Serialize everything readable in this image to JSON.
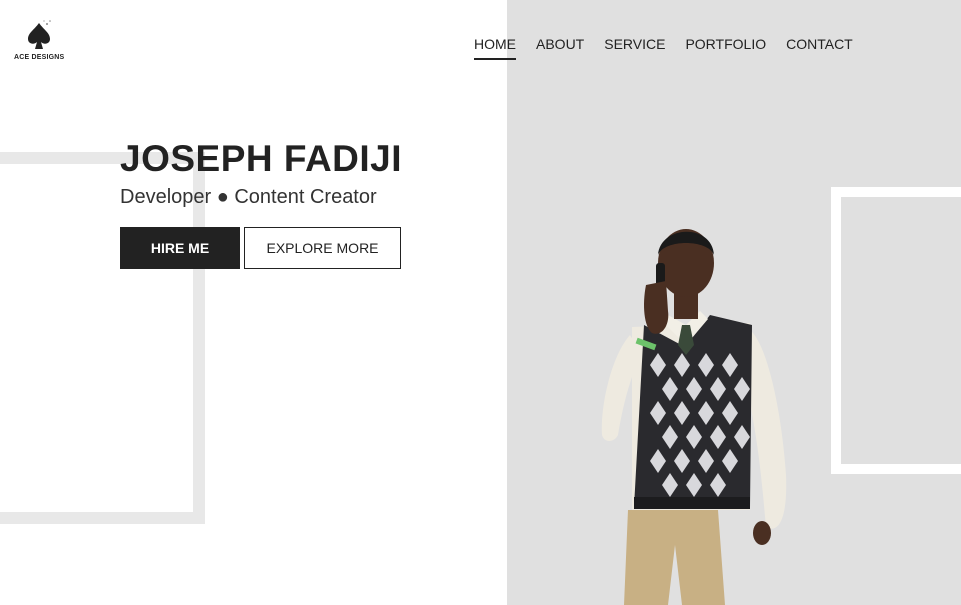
{
  "brand": {
    "name": "ACE DESIGNS",
    "logo_icon": "spade-icon"
  },
  "nav": {
    "items": [
      {
        "label": "HOME",
        "active": true
      },
      {
        "label": "ABOUT",
        "active": false
      },
      {
        "label": "SERVICE",
        "active": false
      },
      {
        "label": "PORTFOLIO",
        "active": false
      },
      {
        "label": "CONTACT",
        "active": false
      }
    ]
  },
  "hero": {
    "name": "JOSEPH FADIJI",
    "role": "Developer ● Content Creator",
    "primary_button": "HIRE ME",
    "secondary_button": "EXPLORE MORE"
  },
  "colors": {
    "dark": "#222222",
    "panel": "#e0e0e0",
    "background": "#ffffff"
  }
}
